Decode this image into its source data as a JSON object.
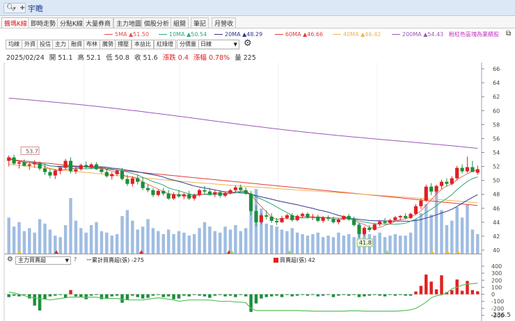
{
  "header": {
    "search_icon": "search-icon",
    "add_icon": "plus-icon",
    "stock_name": "宇瞻"
  },
  "tabs": [
    "醬瑪K線",
    "即時走勢",
    "分點K線",
    "大量券商",
    "主力地圖",
    "個股分析",
    "組閱",
    "筆記",
    "月營收"
  ],
  "ma_legend": [
    {
      "label": "5MA",
      "value": "51.50",
      "color": "#e84a4a"
    },
    {
      "label": "10MA",
      "value": "50.54",
      "color": "#2aa87a"
    },
    {
      "label": "20MA",
      "value": "48.29",
      "color": "#30348a"
    },
    {
      "label": "60MA",
      "value": "46.66",
      "color": "#e23a3a"
    },
    {
      "label": "40MA",
      "value": "46.42",
      "color": "#f0b350"
    },
    {
      "label": "200MA",
      "value": "54.43",
      "color": "#9a55b7"
    }
  ],
  "ma_arrow": "▲",
  "note": "粉紅色區塊為業績股",
  "toolbar": {
    "buttons": [
      "均線",
      "外資",
      "投信",
      "主力",
      "融資",
      "布林",
      "騰勢",
      "撐壓",
      "本益比",
      "紅綠燈",
      "分價量"
    ],
    "period": "日線"
  },
  "quote": {
    "date": "2025/02/24",
    "open_label": "開",
    "open": "51.1",
    "high_label": "高",
    "high": "52.1",
    "low_label": "低",
    "low": "50.8",
    "close_label": "收",
    "close": "51.6",
    "change_label": "漲跌",
    "change": "0.4",
    "pct_label": "漲幅",
    "pct": "0.78%",
    "vol_label": "量",
    "vol": "225"
  },
  "chart_data": [
    {
      "type": "candlestick",
      "y_axis_ticks": [
        40,
        42,
        44,
        46,
        48,
        50,
        52,
        54,
        56,
        58,
        60,
        62,
        64,
        66
      ],
      "ylim": [
        39.5,
        67
      ],
      "annotations": [
        {
          "text": "53.7",
          "value": 53.7
        },
        {
          "text": "41.8",
          "value": 41.8
        }
      ],
      "candles": [
        [
          52.8,
          53.6,
          52.0,
          53.3
        ],
        [
          53.3,
          53.7,
          52.2,
          52.4
        ],
        [
          52.4,
          52.8,
          51.7,
          52.6
        ],
        [
          52.6,
          53.0,
          52.0,
          52.1
        ],
        [
          52.1,
          52.6,
          51.5,
          52.3
        ],
        [
          52.3,
          52.9,
          51.8,
          52.5
        ],
        [
          52.5,
          52.7,
          51.4,
          51.7
        ],
        [
          51.7,
          52.4,
          50.8,
          51.2
        ],
        [
          51.2,
          51.7,
          50.3,
          50.7
        ],
        [
          50.7,
          51.6,
          50.2,
          51.4
        ],
        [
          51.4,
          52.0,
          50.9,
          51.8
        ],
        [
          51.8,
          53.1,
          51.5,
          52.8
        ],
        [
          52.8,
          53.3,
          51.0,
          51.3
        ],
        [
          51.3,
          52.0,
          50.9,
          51.6
        ],
        [
          51.6,
          52.4,
          51.4,
          52.2
        ],
        [
          52.2,
          52.7,
          51.7,
          51.9
        ],
        [
          51.9,
          52.5,
          51.6,
          52.3
        ],
        [
          52.3,
          52.6,
          51.5,
          51.6
        ],
        [
          51.6,
          52.0,
          51.0,
          51.2
        ],
        [
          51.2,
          51.6,
          50.4,
          50.6
        ],
        [
          50.6,
          51.2,
          50.1,
          50.9
        ],
        [
          50.9,
          51.6,
          50.6,
          51.4
        ],
        [
          51.4,
          51.8,
          50.0,
          50.2
        ],
        [
          50.2,
          50.8,
          49.2,
          49.5
        ],
        [
          49.5,
          50.6,
          49.1,
          50.3
        ],
        [
          50.3,
          50.8,
          49.4,
          49.8
        ],
        [
          49.8,
          50.4,
          48.6,
          48.9
        ],
        [
          48.9,
          49.4,
          48.3,
          48.6
        ],
        [
          48.6,
          48.9,
          47.6,
          47.9
        ],
        [
          47.9,
          48.7,
          47.7,
          48.5
        ],
        [
          48.5,
          48.9,
          47.8,
          48.1
        ],
        [
          48.1,
          48.6,
          47.2,
          47.4
        ],
        [
          47.4,
          48.3,
          47.2,
          48.0
        ],
        [
          48.0,
          48.6,
          47.5,
          47.7
        ],
        [
          47.7,
          48.2,
          47.3,
          48.0
        ],
        [
          48.0,
          48.5,
          47.2,
          47.4
        ],
        [
          47.4,
          48.1,
          47.1,
          47.9
        ],
        [
          47.9,
          48.8,
          47.7,
          48.6
        ],
        [
          48.6,
          49.2,
          48.1,
          48.4
        ],
        [
          48.4,
          48.9,
          47.8,
          48.0
        ],
        [
          48.0,
          48.6,
          47.6,
          48.3
        ],
        [
          48.3,
          48.6,
          47.5,
          47.8
        ],
        [
          47.8,
          48.4,
          47.6,
          48.2
        ],
        [
          48.2,
          48.8,
          48.0,
          48.6
        ],
        [
          48.6,
          49.3,
          48.3,
          49.0
        ],
        [
          49.0,
          49.4,
          48.4,
          48.6
        ],
        [
          48.6,
          49.0,
          47.9,
          48.1
        ],
        [
          48.1,
          48.5,
          45.0,
          45.6
        ],
        [
          45.6,
          46.4,
          43.4,
          44.0
        ],
        [
          44.0,
          45.3,
          43.7,
          45.0
        ],
        [
          45.0,
          45.7,
          44.4,
          44.8
        ],
        [
          44.8,
          45.3,
          43.9,
          44.2
        ],
        [
          44.2,
          44.6,
          43.6,
          44.0
        ],
        [
          44.0,
          44.9,
          43.9,
          44.6
        ],
        [
          44.6,
          45.2,
          44.4,
          45.0
        ],
        [
          45.0,
          45.3,
          44.1,
          44.3
        ],
        [
          44.3,
          45.1,
          44.1,
          44.9
        ],
        [
          44.9,
          45.4,
          44.6,
          45.2
        ],
        [
          45.2,
          45.4,
          44.5,
          44.7
        ],
        [
          44.7,
          45.2,
          44.3,
          44.8
        ],
        [
          44.8,
          45.1,
          44.0,
          44.2
        ],
        [
          44.2,
          44.9,
          43.9,
          44.7
        ],
        [
          44.7,
          45.0,
          44.2,
          44.5
        ],
        [
          44.5,
          44.8,
          43.8,
          44.0
        ],
        [
          44.0,
          44.6,
          43.7,
          44.4
        ],
        [
          44.4,
          45.0,
          44.3,
          44.9
        ],
        [
          44.9,
          45.2,
          44.2,
          44.4
        ],
        [
          44.4,
          44.8,
          43.4,
          43.6
        ],
        [
          43.6,
          43.9,
          41.8,
          42.3
        ],
        [
          42.3,
          43.4,
          42.0,
          43.2
        ],
        [
          43.2,
          43.6,
          42.6,
          42.9
        ],
        [
          42.9,
          43.9,
          42.8,
          43.7
        ],
        [
          43.7,
          44.3,
          43.4,
          44.1
        ],
        [
          44.1,
          44.6,
          43.7,
          43.9
        ],
        [
          43.9,
          44.5,
          43.7,
          44.3
        ],
        [
          44.3,
          44.9,
          44.1,
          44.7
        ],
        [
          44.7,
          45.0,
          44.3,
          44.9
        ],
        [
          44.9,
          45.3,
          44.4,
          44.6
        ],
        [
          44.6,
          45.4,
          44.5,
          45.2
        ],
        [
          45.2,
          46.6,
          45.0,
          46.3
        ],
        [
          46.3,
          47.4,
          45.9,
          47.1
        ],
        [
          47.1,
          49.4,
          46.9,
          49.1
        ],
        [
          49.1,
          49.6,
          47.9,
          48.4
        ],
        [
          48.4,
          49.4,
          48.1,
          49.2
        ],
        [
          49.2,
          50.1,
          48.8,
          49.8
        ],
        [
          49.8,
          50.3,
          49.1,
          49.5
        ],
        [
          49.5,
          50.6,
          49.3,
          50.3
        ],
        [
          50.3,
          52.1,
          50.0,
          51.8
        ],
        [
          51.8,
          52.3,
          51.0,
          51.3
        ],
        [
          51.3,
          53.4,
          51.1,
          51.9
        ],
        [
          51.9,
          52.8,
          51.3,
          51.2
        ],
        [
          51.1,
          52.1,
          50.8,
          51.6
        ]
      ]
    },
    {
      "type": "bar",
      "title": "volume",
      "values": [
        2400,
        1800,
        2100,
        1500,
        1700,
        1400,
        2300,
        2000,
        1600,
        1200,
        1100,
        1900,
        3700,
        2200,
        1700,
        1400,
        1900,
        2100,
        1500,
        1400,
        1200,
        1300,
        2500,
        2900,
        2200,
        1600,
        1800,
        2300,
        1700,
        1500,
        1300,
        1600,
        1300,
        1500,
        1400,
        1200,
        1300,
        1700,
        2100,
        1800,
        1500,
        1400,
        1800,
        1600,
        1900,
        1500,
        1700,
        2900,
        4300,
        3000,
        2000,
        1900,
        1800,
        1600,
        1500,
        1700,
        1400,
        1300,
        1200,
        1300,
        1400,
        1100,
        1200,
        1100,
        1400,
        1200,
        1300,
        1100,
        2000,
        1600,
        1300,
        1200,
        1400,
        1100,
        1200,
        1300,
        1200,
        1200,
        1400,
        2300,
        2700,
        3300,
        2600,
        4400,
        2900,
        1900,
        2200,
        3100,
        2400,
        3300,
        1600,
        1300
      ]
    },
    {
      "type": "bar",
      "title": "主力買賣超",
      "y_axis_ticks": [
        -300,
        -200,
        -100,
        0,
        100,
        200,
        300,
        400
      ],
      "ylim": [
        -340,
        430
      ],
      "legend": [
        {
          "label": "一累計買賣超(張)",
          "value": "-275"
        },
        {
          "label": "買賣超(張)",
          "value": "42"
        }
      ],
      "min_label": "-236.5",
      "values": [
        -40,
        -20,
        -30,
        -10,
        -60,
        -160,
        -230,
        -70,
        -30,
        -20,
        -10,
        -50,
        60,
        -30,
        -40,
        -70,
        -20,
        -10,
        -70,
        -60,
        -30,
        -20,
        -120,
        -80,
        -20,
        -40,
        -60,
        -50,
        -20,
        -10,
        -40,
        -30,
        -70,
        -60,
        -20,
        -30,
        -10,
        -20,
        -30,
        -50,
        -20,
        -10,
        -30,
        -20,
        -40,
        -10,
        -30,
        -250,
        -130,
        -60,
        -40,
        -30,
        -20,
        -40,
        -10,
        -30,
        -20,
        -10,
        -20,
        -10,
        -30,
        -20,
        -10,
        -40,
        -20,
        -10,
        -20,
        -10,
        -40,
        -30,
        -20,
        -10,
        -20,
        -30,
        -10,
        -20,
        -10,
        -20,
        -20,
        40,
        120,
        280,
        180,
        70,
        270,
        30,
        60,
        210,
        50,
        190,
        60,
        42
      ],
      "cumulative": [
        30,
        20,
        0,
        -20,
        -40,
        -50,
        -60,
        -70,
        -80,
        -70,
        -60,
        -50,
        -40,
        -40,
        -40,
        -40,
        -40,
        -40,
        -50,
        -60,
        -60,
        -60,
        -70,
        -80,
        -80,
        -80,
        -80,
        -70,
        -60,
        -50,
        -60,
        -70,
        -80,
        -100,
        -90,
        -80,
        -80,
        -80,
        -80,
        -80,
        -90,
        -100,
        -100,
        -100,
        -110,
        -110,
        -120,
        -200,
        -230,
        -230,
        -230,
        -230,
        -230,
        -230,
        -230,
        -230,
        -230,
        -235,
        -235,
        -240,
        -240,
        -240,
        -240,
        -240,
        -240,
        -240,
        -235,
        -235,
        -235,
        -240,
        -240,
        -240,
        -240,
        -240,
        -240,
        -240,
        -235,
        -230,
        -220,
        -200,
        -160,
        -110,
        -50,
        -20,
        -10,
        20,
        80,
        100,
        130,
        145,
        150,
        160
      ]
    }
  ],
  "indicator": {
    "selected": "主力買賣超",
    "help": "?"
  }
}
